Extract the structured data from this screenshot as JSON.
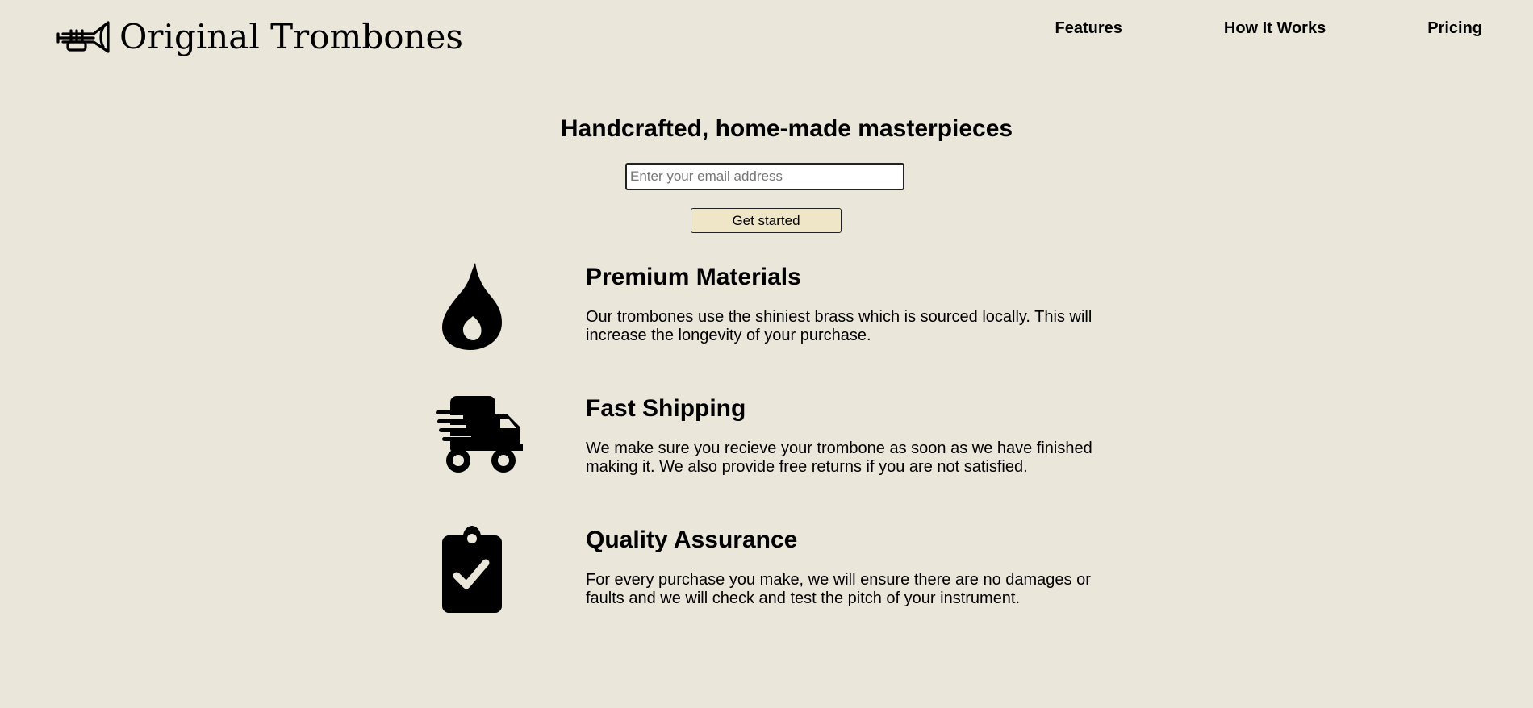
{
  "brand": {
    "name": "Original Trombones",
    "logo_icon": "trumpet-icon"
  },
  "nav": [
    {
      "label": "Features"
    },
    {
      "label": "How It Works"
    },
    {
      "label": "Pricing"
    }
  ],
  "hero": {
    "heading": "Handcrafted, home-made masterpieces",
    "email_placeholder": "Enter your email address",
    "email_value": "",
    "button_label": "Get started"
  },
  "features": [
    {
      "icon": "fire-icon",
      "title": "Premium Materials",
      "description": "Our trombones use the shiniest brass which is sourced locally. This will increase the longevity of your purchase."
    },
    {
      "icon": "shipping-truck-icon",
      "title": "Fast Shipping",
      "description": "We make sure you recieve your trombone as soon as we have finished making it. We also provide free returns if you are not satisfied."
    },
    {
      "icon": "clipboard-check-icon",
      "title": "Quality Assurance",
      "description": "For every purchase you make, we will ensure there are no damages or faults and we will check and test the pitch of your instrument."
    }
  ],
  "colors": {
    "background": "#eae6da",
    "button_background": "#efe6c7",
    "text": "#000000"
  }
}
